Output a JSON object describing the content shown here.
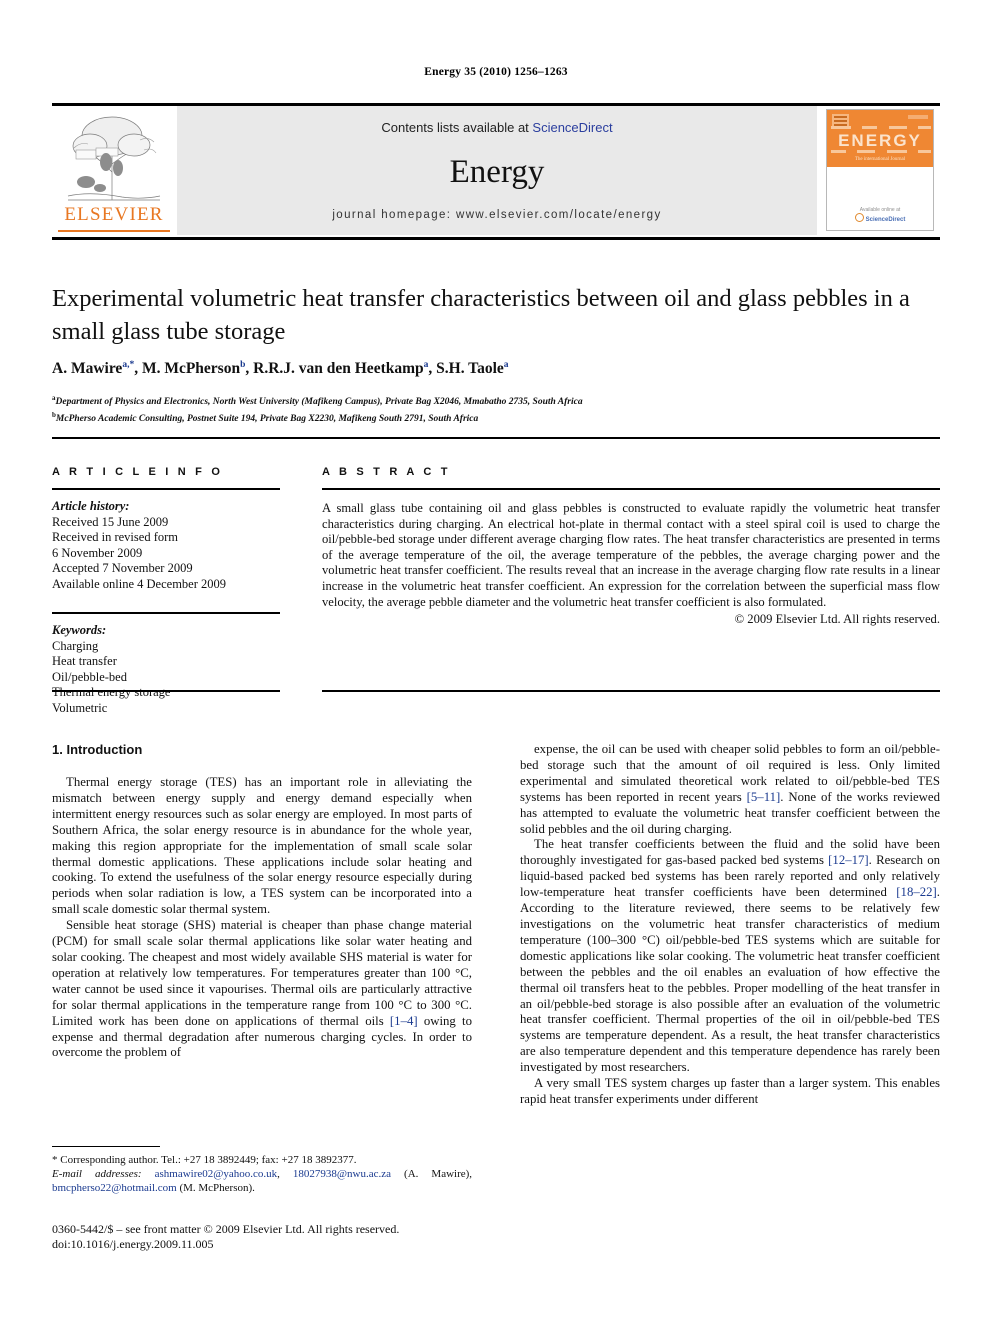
{
  "running_head": "Energy 35 (2010) 1256–1263",
  "masthead": {
    "publisher_name": "ELSEVIER",
    "contents_prefix": "Contents lists available at ",
    "sciencedirect": "ScienceDirect",
    "journal_title": "Energy",
    "homepage": "journal homepage: www.elsevier.com/locate/energy",
    "cover": {
      "title": "ENERGY",
      "subtitle": "The international Journal",
      "platform_prefix": "Available online at",
      "platform": "ScienceDirect"
    },
    "accent_orange": "#E87722",
    "link_blue": "#2b3e9e",
    "panel_grey": "#e9e9e9"
  },
  "article": {
    "title": "Experimental volumetric heat transfer characteristics between oil and glass pebbles in a small glass tube storage",
    "authors": [
      {
        "name": "A. Mawire",
        "marks": "a,*"
      },
      {
        "name": "M. McPherson",
        "marks": "b"
      },
      {
        "name": "R.R.J. van den Heetkamp",
        "marks": "a"
      },
      {
        "name": "S.H. Taole",
        "marks": "a"
      }
    ],
    "affiliations": [
      {
        "mark": "a",
        "text": "Department of Physics and Electronics, North West University (Mafikeng Campus), Private Bag X2046, Mmabatho 2735, South Africa"
      },
      {
        "mark": "b",
        "text": "McPherso Academic Consulting, Postnet Suite 194, Private Bag X2230, Mafikeng South 2791, South Africa"
      }
    ]
  },
  "article_info": {
    "heading": "A R T I C L E    I N F O",
    "history_label": "Article history:",
    "history": [
      "Received 15 June 2009",
      "Received in revised form",
      "6 November 2009",
      "Accepted 7 November 2009",
      "Available online 4 December 2009"
    ],
    "keywords_label": "Keywords:",
    "keywords": [
      "Charging",
      "Heat transfer",
      "Oil/pebble-bed",
      "Thermal energy storage",
      "Volumetric"
    ]
  },
  "abstract": {
    "heading": "A B S T R A C T",
    "text": "A small glass tube containing oil and glass pebbles is constructed to evaluate rapidly the volumetric heat transfer characteristics during charging. An electrical hot-plate in thermal contact with a steel spiral coil is used to charge the oil/pebble-bed storage under different average charging flow rates. The heat transfer characteristics are presented in terms of the average temperature of the oil, the average temperature of the pebbles, the average charging power and the volumetric heat transfer coefficient. The results reveal that an increase in the average charging flow rate results in a linear increase in the volumetric heat transfer coefficient. An expression for the correlation between the superficial mass flow velocity, the average pebble diameter and the volumetric heat transfer coefficient is also formulated.",
    "copyright": "© 2009 Elsevier Ltd. All rights reserved."
  },
  "body": {
    "section_heading": "1. Introduction",
    "left_paragraphs": [
      "Thermal energy storage (TES) has an important role in alleviating the mismatch between energy supply and energy demand especially when intermittent energy resources such as solar energy are employed. In most parts of Southern Africa, the solar energy resource is in abundance for the whole year, making this region appropriate for the implementation of small scale solar thermal domestic applications. These applications include solar heating and cooking. To extend the usefulness of the solar energy resource especially during periods when solar radiation is low, a TES system can be incorporated into a small scale domestic solar thermal system.",
      "Sensible heat storage (SHS) material is cheaper than phase change material (PCM) for small scale solar thermal applications like solar water heating and solar cooking. The cheapest and most widely available SHS material is water for operation at relatively low temperatures. For temperatures greater than 100 °C, water cannot be used since it vapourises. Thermal oils are particularly attractive for solar thermal applications in the temperature range from 100 °C to 300 °C. Limited work has been done on applications of thermal oils [1–4] owing to expense and thermal degradation after numerous charging cycles. In order to overcome the problem of"
    ],
    "right_paragraphs": [
      "expense, the oil can be used with cheaper solid pebbles to form an oil/pebble-bed storage such that the amount of oil required is less. Only limited experimental and simulated theoretical work related to oil/pebble-bed TES systems has been reported in recent years [5–11]. None of the works reviewed has attempted to evaluate the volumetric heat transfer coefficient between the solid pebbles and the oil during charging.",
      "The heat transfer coefficients between the fluid and the solid have been thoroughly investigated for gas-based packed bed systems [12–17]. Research on liquid-based packed bed systems has been rarely reported and only relatively low-temperature heat transfer coefficients have been determined [18–22]. According to the literature reviewed, there seems to be relatively few investigations on the volumetric heat transfer characteristics of medium temperature (100–300 °C) oil/pebble-bed TES systems which are suitable for domestic applications like solar cooking. The volumetric heat transfer coefficient between the pebbles and the oil enables an evaluation of how effective the thermal oil transfers heat to the pebbles. Proper modelling of the heat transfer in an oil/pebble-bed storage is also possible after an evaluation of the volumetric heat transfer coefficient. Thermal properties of the oil in oil/pebble-bed TES systems are temperature dependent. As a result, the heat transfer characteristics are also temperature dependent and this temperature dependence has rarely been investigated by most researchers.",
      "A very small TES system charges up faster than a larger system. This enables rapid heat transfer experiments under different"
    ],
    "reference_marks": [
      "[1–4]",
      "[5–11]",
      "[12–17]",
      "[18–22]"
    ]
  },
  "footnote": {
    "corresponding": "* Corresponding author. Tel.: +27 18 3892449; fax: +27 18 3892377.",
    "email_label": "E-mail addresses:",
    "emails": [
      {
        "address": "ashmawire02@yahoo.co.uk",
        "sep": ", "
      },
      {
        "address": "18027938@nwu.ac.za",
        "sep": " "
      }
    ],
    "email_owner_1": "(A. Mawire),",
    "email_3": "bmcpherso22@hotmail.com",
    "email_owner_2": "(M. McPherson)."
  },
  "imprint": {
    "issn_line": "0360-5442/$ – see front matter © 2009 Elsevier Ltd. All rights reserved.",
    "doi_line": "doi:10.1016/j.energy.2009.11.005"
  }
}
